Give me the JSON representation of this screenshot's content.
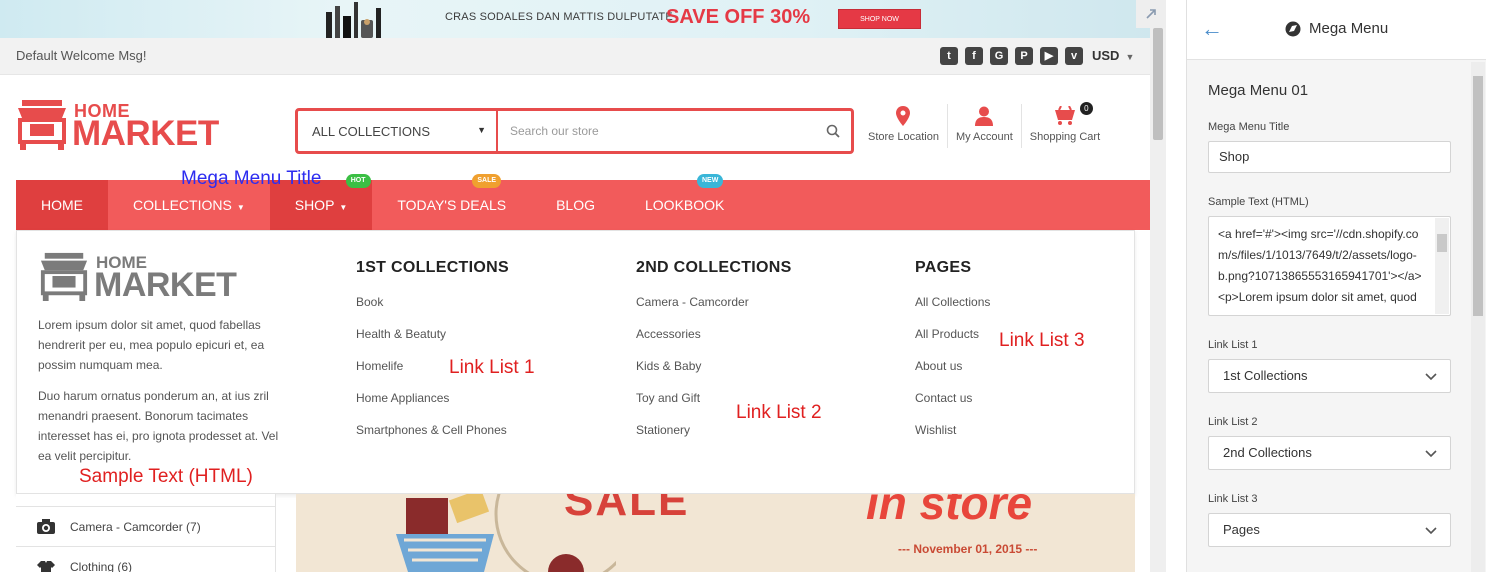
{
  "promo": {
    "text": "CRAS SODALES DAN MATTIS DULPUTATE",
    "save": "SAVE OFF 30%",
    "button": "SHOP NOW"
  },
  "topbar": {
    "welcome": "Default Welcome Msg!",
    "socials": [
      "twitter-icon",
      "facebook-icon",
      "google-plus-icon",
      "pinterest-icon",
      "youtube-icon",
      "vimeo-icon"
    ],
    "currency": "USD"
  },
  "logo": {
    "line1": "HOME",
    "line2": "MARKET"
  },
  "search": {
    "collection": "ALL COLLECTIONS",
    "placeholder": "Search our store"
  },
  "header_icons": {
    "store_location": "Store Location",
    "my_account": "My Account",
    "shopping_cart": "Shopping Cart",
    "cart_count": "0"
  },
  "nav": {
    "items": [
      {
        "label": "HOME"
      },
      {
        "label": "COLLECTIONS"
      },
      {
        "label": "SHOP",
        "badge": "HOT"
      },
      {
        "label": "TODAY'S DEALS",
        "badge": "SALE"
      },
      {
        "label": "BLOG"
      },
      {
        "label": "LOOKBOOK",
        "badge": "NEW"
      }
    ]
  },
  "mega_menu": {
    "logo": {
      "line1": "HOME",
      "line2": "MARKET"
    },
    "para1": "Lorem ipsum dolor sit amet, quod fabellas hendrerit per eu, mea populo epicuri et, ea possim numquam mea.",
    "para2": "Duo harum ornatus ponderum an, at ius zril menandri praesent. Bonorum tacimates interesset has ei, pro ignota prodesset at. Vel ea velit percipitur.",
    "col1": {
      "title": "1ST COLLECTIONS",
      "links": [
        "Book",
        "Health & Beatuty",
        "Homelife",
        "Home Appliances",
        "Smartphones & Cell Phones"
      ]
    },
    "col2": {
      "title": "2ND COLLECTIONS",
      "links": [
        "Camera - Camcorder",
        "Accessories",
        "Kids & Baby",
        "Toy and Gift",
        "Stationery"
      ]
    },
    "col3": {
      "title": "PAGES",
      "links": [
        "All Collections",
        "All Products",
        "About us",
        "Contact us",
        "Wishlist"
      ]
    }
  },
  "annotations": {
    "mega_menu_title": "Mega Menu Title",
    "link_list_1": "Link List 1",
    "link_list_2": "Link List 2",
    "link_list_3": "Link List 3",
    "sample_text": "Sample Text (HTML)"
  },
  "categories": [
    {
      "label": "Camera - Camcorder (7)",
      "icon": "camera-icon"
    },
    {
      "label": "Clothing (6)",
      "icon": "clothing-icon"
    }
  ],
  "banner": {
    "sale": "SALE",
    "instore": "in store",
    "date": "--- November 01, 2015 ---"
  },
  "panel": {
    "title": "Mega Menu",
    "section": "Mega Menu 01",
    "title_label": "Mega Menu Title",
    "title_value": "Shop",
    "sample_label": "Sample Text (HTML)",
    "sample_value": "<a href='#'><img src='//cdn.shopify.com/s/files/1/1013/7649/t/2/assets/logo-b.png?10713865553165941701'></a><p>Lorem ipsum dolor sit amet, quod",
    "link1_label": "Link List 1",
    "link1_value": "1st Collections",
    "link2_label": "Link List 2",
    "link2_value": "2nd Collections",
    "link3_label": "Link List 3",
    "link3_value": "Pages"
  },
  "colors": {
    "accent": "#f25b5b",
    "brand": "#e74c4c",
    "annotation_red": "#e02020",
    "annotation_blue": "#2d2df0",
    "panel_link": "#4a8cca"
  }
}
